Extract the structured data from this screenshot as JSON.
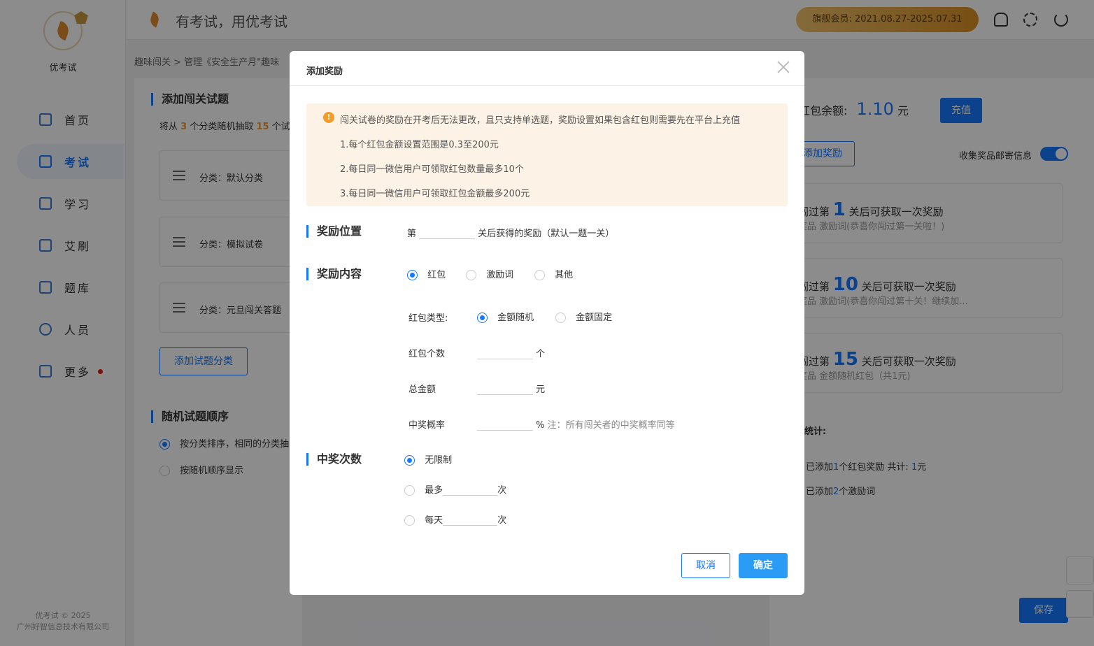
{
  "app": {
    "name": "优考试",
    "slogan": "有考试，用优考试"
  },
  "header": {
    "vip_text": "旗舰会员: 2021.08.27-2025.07.31"
  },
  "sidebar": {
    "items": [
      {
        "label": "首页"
      },
      {
        "label": "考试"
      },
      {
        "label": "学习"
      },
      {
        "label": "艾刷"
      },
      {
        "label": "题库"
      },
      {
        "label": "人员"
      },
      {
        "label": "更多"
      }
    ],
    "copyright_line1": "优考试 © 2025",
    "copyright_line2": "广州好智信息技术有限公司"
  },
  "breadcrumb": "趣味闯关 > 管理《安全生产月\"趣味",
  "left_panel": {
    "title": "添加闯关试题",
    "desc_prefix": "将从",
    "desc_num1": "3",
    "desc_mid": "个分类随机抽取",
    "desc_num2": "15",
    "desc_suffix": "个试",
    "categories": [
      {
        "label": "分类：默认分类"
      },
      {
        "label": "分类：模拟试卷"
      },
      {
        "label": "分类：元旦闯关答题"
      }
    ],
    "add_category_btn": "添加试题分类",
    "order_title": "随机试题顺序",
    "order_opt1": "按分类排序，相同的分类抽",
    "order_opt2": "按随机顺序显示"
  },
  "right_panel": {
    "balance_label": "红包余额:",
    "balance_value": "1.10",
    "balance_unit": "元",
    "recharge_btn": "充值",
    "add_reward_btn": "添加奖励",
    "collect_label": "收集奖品邮寄信息",
    "rewards": [
      {
        "prefix": "闯过第",
        "num": "1",
        "suffix": "关后可获取一次奖励",
        "detail": "奖品 激励词(恭喜你闯过第一关啦！)"
      },
      {
        "prefix": "闯过第",
        "num": "10",
        "suffix": "关后可获取一次奖励",
        "detail": "奖品 激励词(恭喜你闯过第十关！继续加..."
      },
      {
        "prefix": "闯过第",
        "num": "15",
        "suffix": "关后可获取一次奖励",
        "detail": "奖品 金额随机红包（共1元)"
      }
    ],
    "stats_title": "统计:",
    "stat1_prefix": "已添加",
    "stat1_num": "1",
    "stat1_mid": "个红包奖励 共计:",
    "stat1_total": "1",
    "stat1_unit": "元",
    "stat2_prefix": "已添加",
    "stat2_num": "2",
    "stat2_suffix": "个激励词",
    "save_btn": "保存"
  },
  "modal": {
    "title": "添加奖励",
    "notice_main": "闯关试卷的奖励在开考后无法更改，且只支持单选题，奖励设置如果包含红包则需要先在平台上充值",
    "notice_1": "1.每个红包金额设置范围是0.3至200元",
    "notice_2": "2.每日同一微信用户可领取红包数量最多10个",
    "notice_3": "3.每日同一微信用户可领取红包金额最多200元",
    "position_title": "奖励位置",
    "position_prefix": "第",
    "position_suffix": "关后获得的奖励（默认一题一关）",
    "content_title": "奖励内容",
    "content_opts": [
      "红包",
      "激励词",
      "其他"
    ],
    "rp_type_label": "红包类型:",
    "rp_type_opts": [
      "金额随机",
      "金额固定"
    ],
    "rp_count_label": "红包个数",
    "rp_count_unit": "个",
    "rp_total_label": "总金额",
    "rp_total_unit": "元",
    "rp_prob_label": "中奖概率",
    "rp_prob_unit": "%",
    "rp_prob_note": "注：所有闯关者的中奖概率同等",
    "times_title": "中奖次数",
    "times_opt1": "无限制",
    "times_opt2_prefix": "最多",
    "times_opt2_suffix": "次",
    "times_opt3_prefix": "每天",
    "times_opt3_suffix": "次",
    "cancel_btn": "取消",
    "confirm_btn": "确定"
  },
  "colors": {
    "primary": "#1677ff",
    "accent": "#f39c2a",
    "notice_bg": "#fdf2e6"
  }
}
